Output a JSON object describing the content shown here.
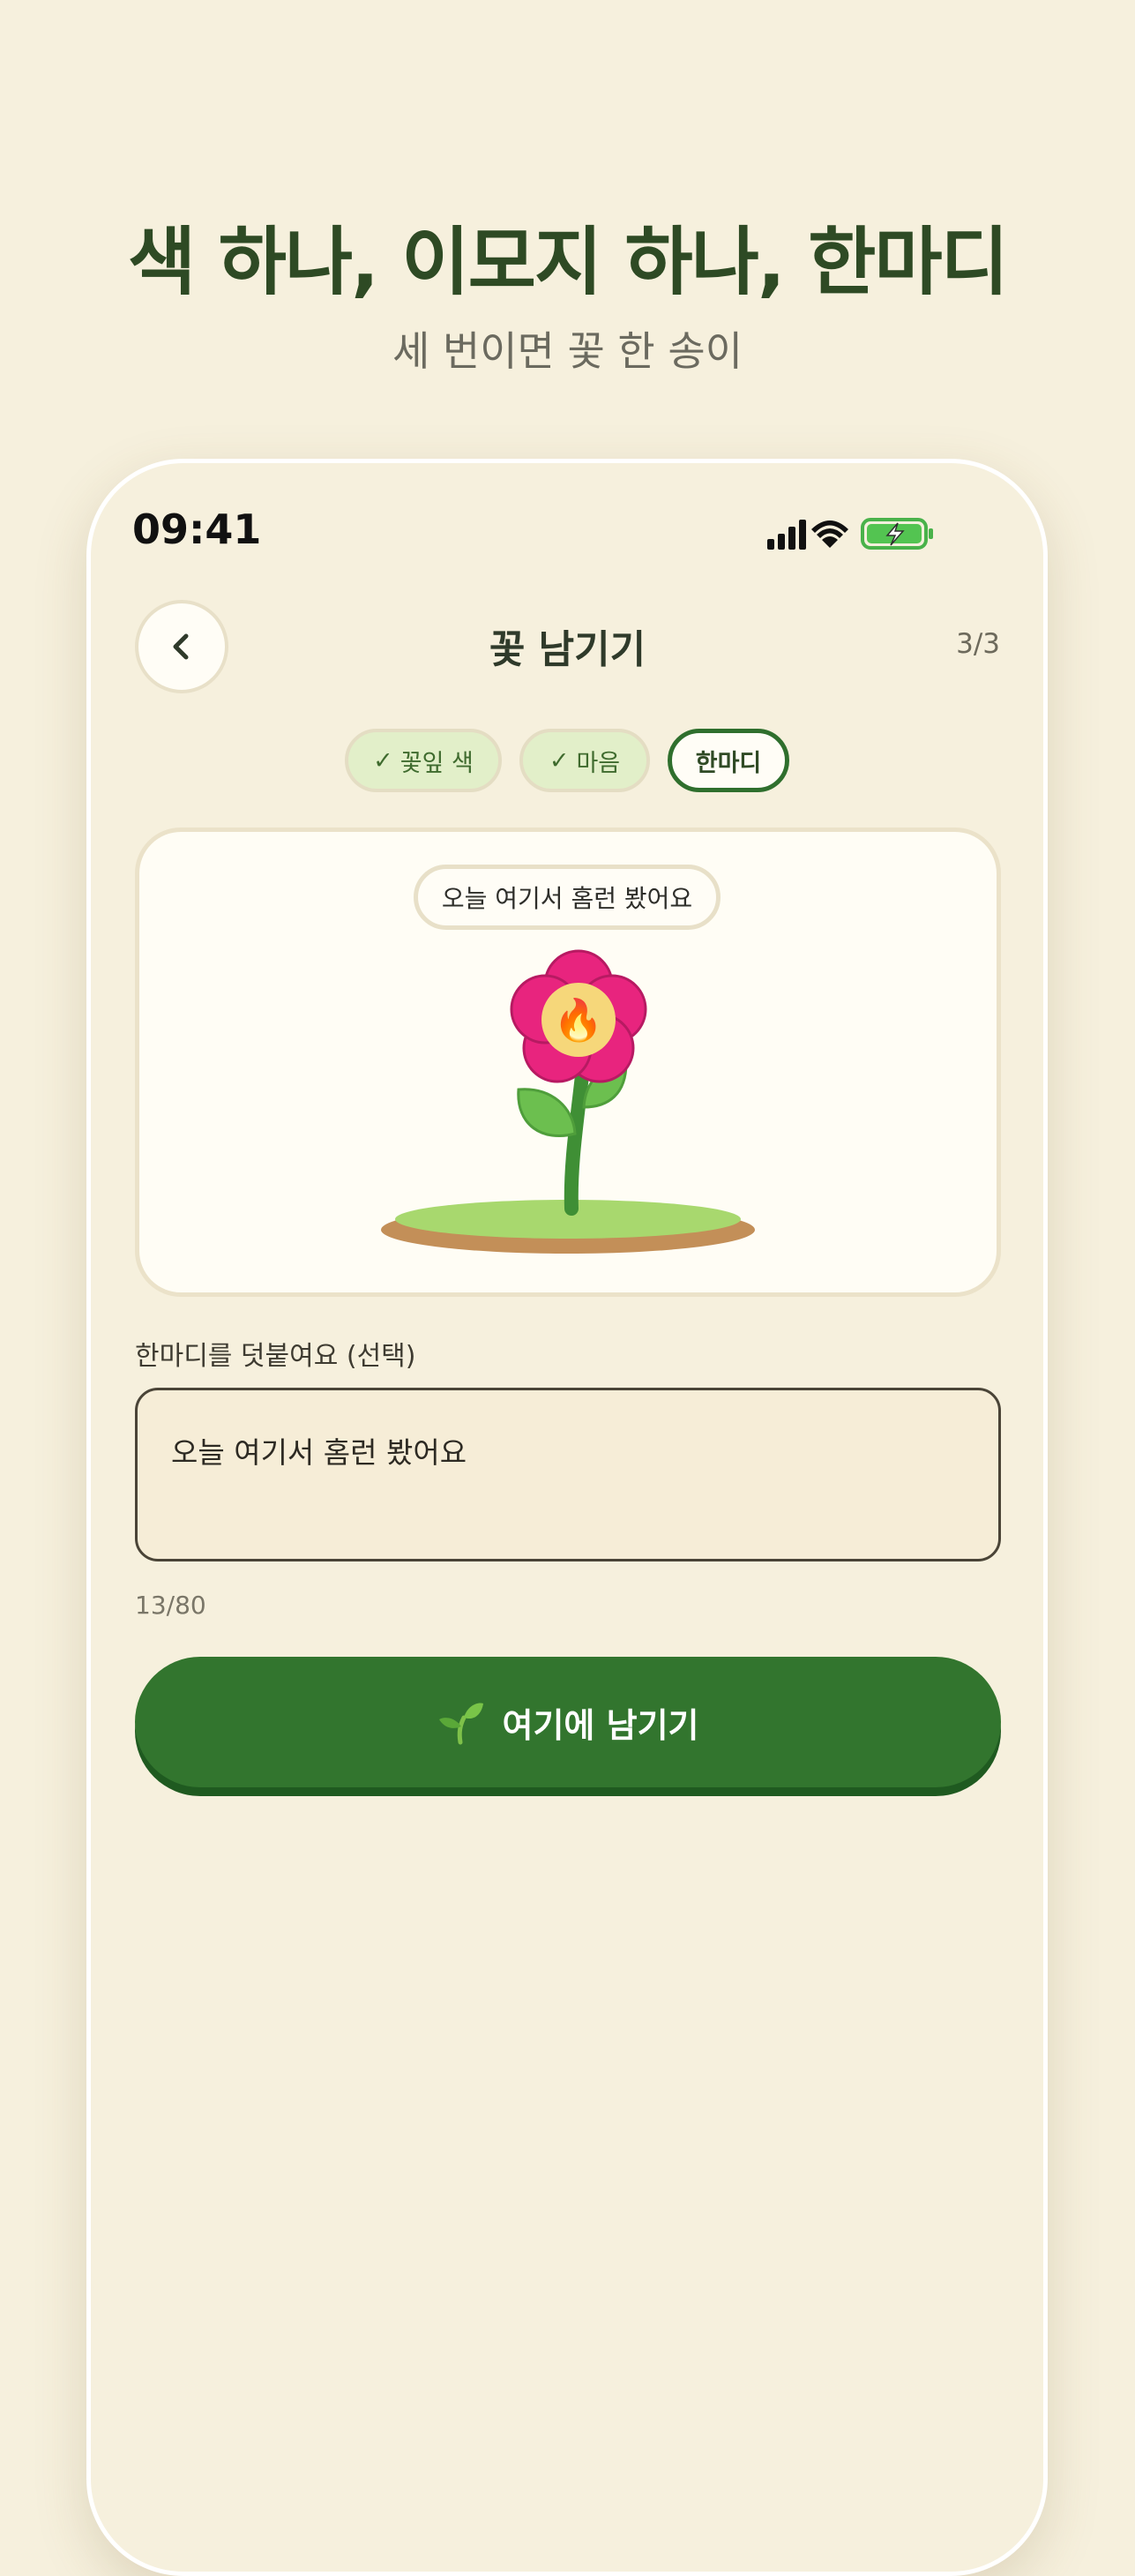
{
  "header": {
    "title": "색 하나, 이모지 하나, 한마디",
    "subtitle": "세 번이면 꽃 한 송이"
  },
  "status_bar": {
    "time": "09:41",
    "icons": [
      "signal-icon",
      "wifi-icon",
      "battery-charging-icon"
    ]
  },
  "nav": {
    "back_icon": "chevron-left-icon",
    "title": "꽃 남기기",
    "step": "3/3"
  },
  "steps": [
    {
      "label": "꽃잎 색",
      "state": "done",
      "mark": "✓"
    },
    {
      "label": "마음",
      "state": "done",
      "mark": "✓"
    },
    {
      "label": "한마디",
      "state": "active"
    }
  ],
  "preview": {
    "message": "오늘 여기서 홈런 봤어요",
    "flower_emoji": "🔥",
    "petal_color": "#e8247e",
    "center_color": "#f6d77a",
    "stem_color": "#3f8f35",
    "grass_color": "#a8d86e",
    "soil_color": "#c38f58"
  },
  "form": {
    "label": "한마디를 덧붙여요 (선택)",
    "value": "오늘 여기서 홈런 봤어요",
    "counter": "13/80"
  },
  "cta": {
    "icon": "sprout-icon",
    "label": "여기에 남기기",
    "color": "#32752e"
  }
}
